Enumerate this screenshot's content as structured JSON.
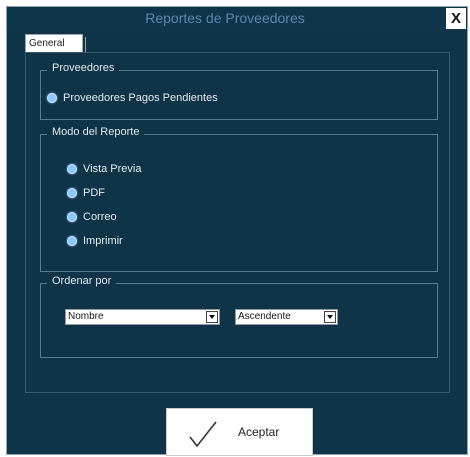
{
  "window": {
    "title": "Reportes de Proveedores",
    "close_label": "X"
  },
  "tabs": [
    {
      "label": "General"
    }
  ],
  "proveedores": {
    "title": "Proveedores",
    "option": "Proveedores Pagos Pendientes"
  },
  "modo": {
    "title": "Modo del  Reporte",
    "options": [
      "Vista Previa",
      "PDF",
      "Correo",
      "Imprimir"
    ]
  },
  "ordenar": {
    "title": "Ordenar por",
    "field_value": "Nombre",
    "direction_value": "Ascendente"
  },
  "accept_button": {
    "label": "Aceptar",
    "icon": "checkmark-icon"
  },
  "colors": {
    "background": "#0f3347",
    "title_text": "#5f86ad",
    "radio": "#8cc9ff"
  }
}
